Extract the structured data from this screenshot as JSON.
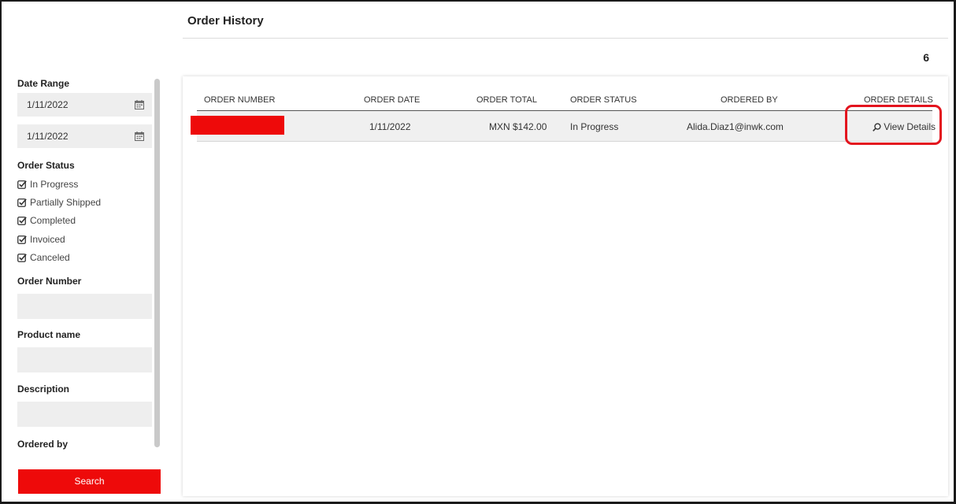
{
  "header": {
    "title": "Order History",
    "result_count": "6"
  },
  "filters": {
    "date_range_label": "Date Range",
    "date_from": "1/11/2022",
    "date_to": "1/11/2022",
    "order_status_label": "Order Status",
    "statuses": [
      {
        "label": "In Progress",
        "checked": true
      },
      {
        "label": "Partially Shipped",
        "checked": true
      },
      {
        "label": "Completed",
        "checked": true
      },
      {
        "label": "Invoiced",
        "checked": true
      },
      {
        "label": "Canceled",
        "checked": true
      }
    ],
    "order_number_label": "Order Number",
    "order_number_value": "",
    "product_name_label": "Product name",
    "product_name_value": "",
    "description_label": "Description",
    "description_value": "",
    "ordered_by_label": "Ordered by",
    "ordered_by_value": "",
    "search_label": "Search"
  },
  "table": {
    "columns": [
      "ORDER NUMBER",
      "ORDER DATE",
      "ORDER TOTAL",
      "ORDER STATUS",
      "ORDERED BY",
      "ORDER DETAILS"
    ],
    "rows": [
      {
        "order_date": "1/11/2022",
        "order_total": "MXN $142.00",
        "order_status": "In Progress",
        "ordered_by": "Alida.Diaz1@inwk.com",
        "details_label": "View Details"
      }
    ]
  },
  "colors": {
    "accent": "#ee0a0a",
    "highlight": "#e3141e"
  },
  "icons": {
    "date": "calendar-icon",
    "status": "checkbox-checked-icon",
    "details": "search-icon"
  }
}
